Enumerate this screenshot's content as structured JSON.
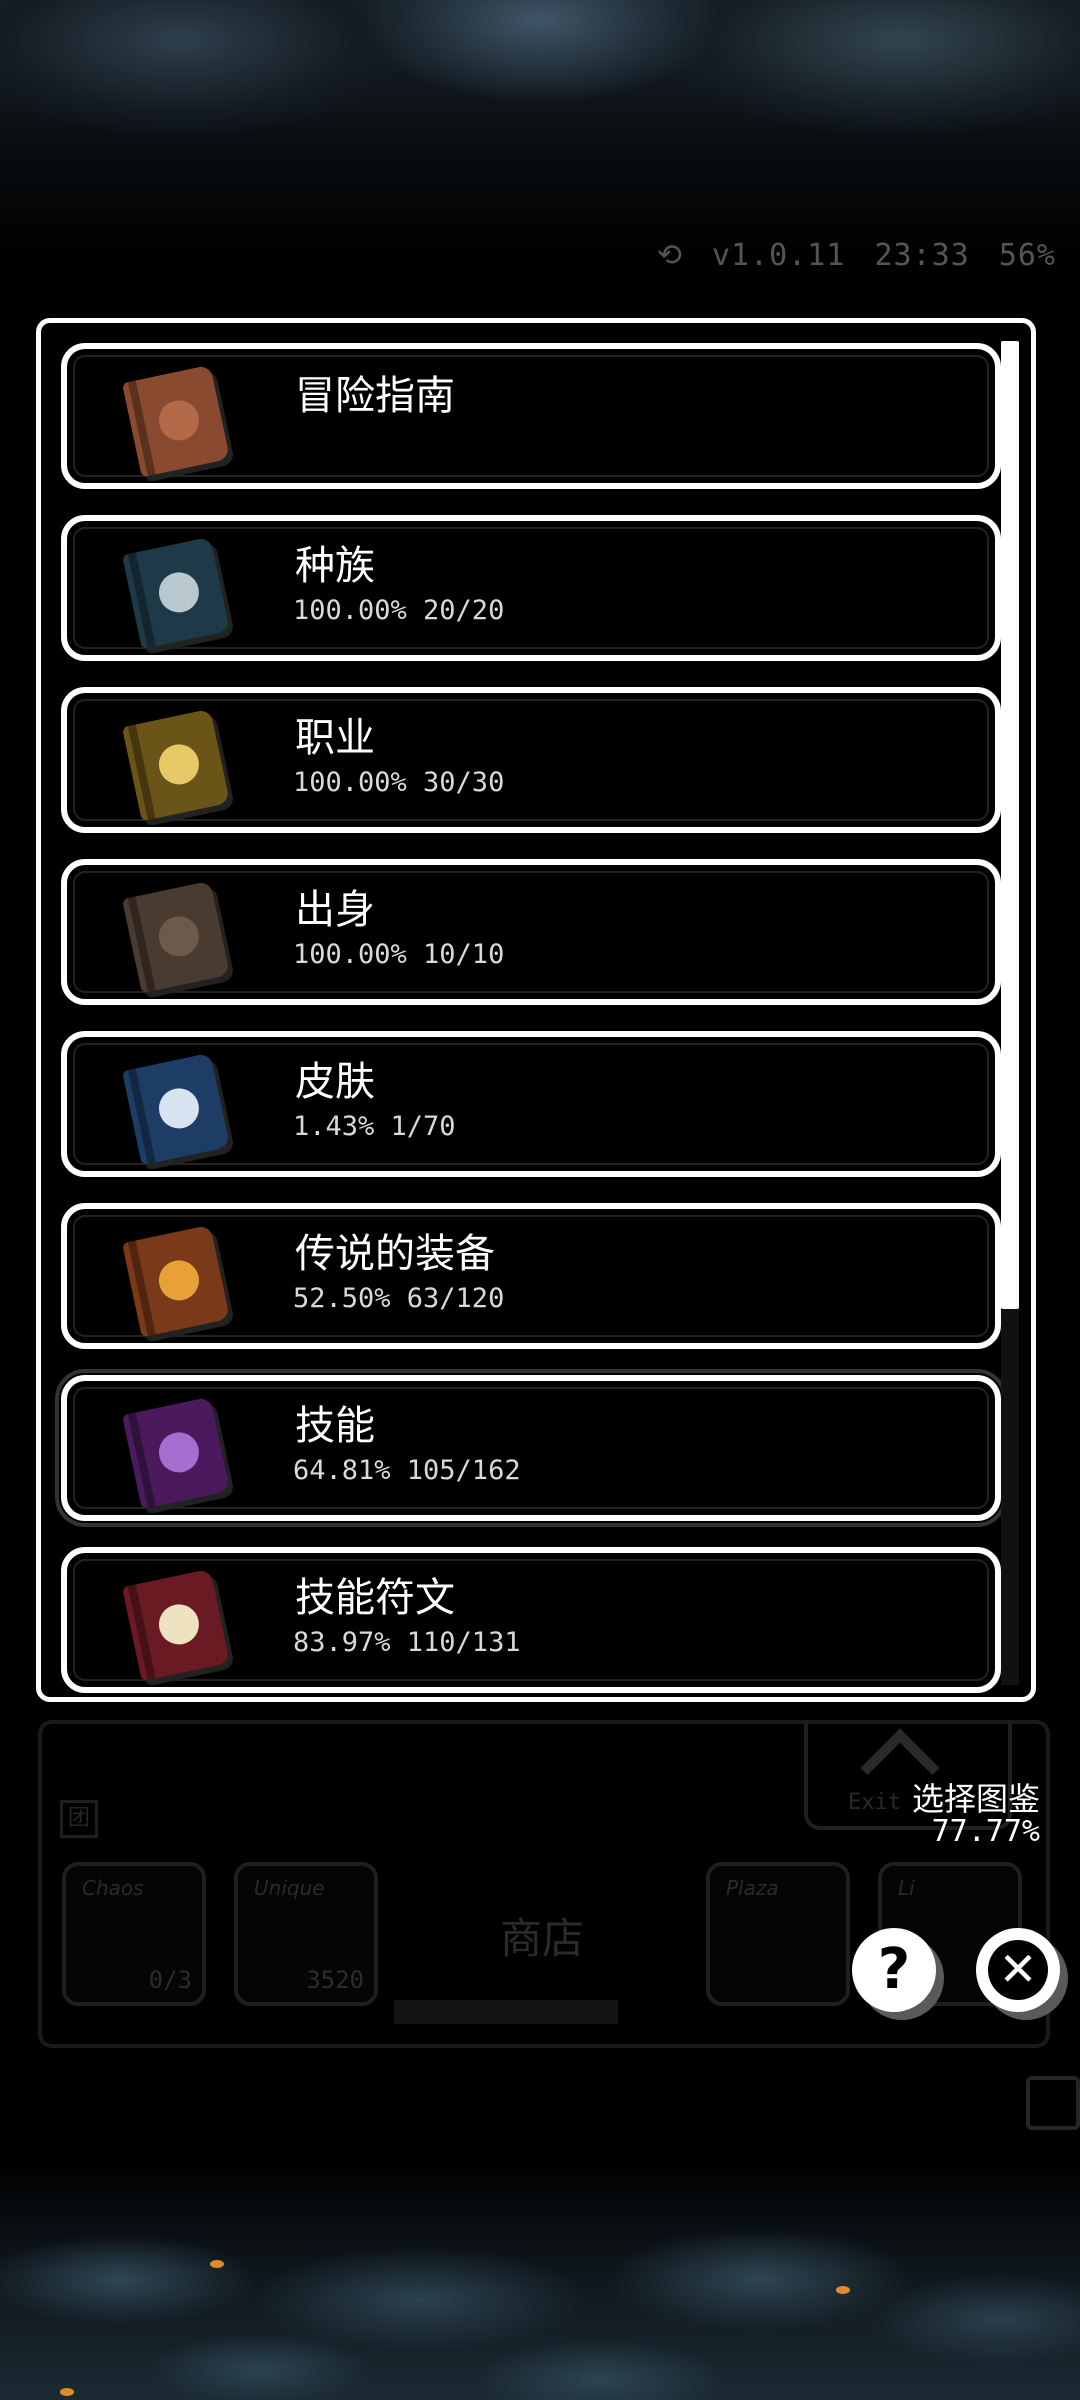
{
  "status": {
    "version": "v1.0.11",
    "time": "23:33",
    "battery": "56%"
  },
  "background": {
    "slots": [
      {
        "title": "Chaos",
        "count": "0/3"
      },
      {
        "title": "Unique",
        "count": "3520"
      },
      {
        "title": "Plaza",
        "count": ""
      },
      {
        "title": "Li",
        "count": ""
      }
    ],
    "shop_label": "商店",
    "exit_label": "Exit"
  },
  "catalog": {
    "items": [
      {
        "name": "冒险指南",
        "stat": "",
        "book_color": "#8a4a30",
        "emblem_color": "#b36a48",
        "icon": "guide-book-icon"
      },
      {
        "name": "种族",
        "stat": "100.00% 20/20",
        "book_color": "#1e3947",
        "emblem_color": "#b9c7cf",
        "icon": "race-book-icon"
      },
      {
        "name": "职业",
        "stat": "100.00% 30/30",
        "book_color": "#6a5418",
        "emblem_color": "#e6c867",
        "icon": "class-book-icon"
      },
      {
        "name": "出身",
        "stat": "100.00% 10/10",
        "book_color": "#4a3b31",
        "emblem_color": "#6d5a4c",
        "icon": "origin-book-icon"
      },
      {
        "name": "皮肤",
        "stat": "1.43% 1/70",
        "book_color": "#1e3d66",
        "emblem_color": "#d7e3f0",
        "icon": "skin-book-icon"
      },
      {
        "name": "传说的装备",
        "stat": "52.50% 63/120",
        "book_color": "#7a3a1a",
        "emblem_color": "#e8a038",
        "icon": "legendary-gear-book-icon"
      },
      {
        "name": "技能",
        "stat": "64.81% 105/162",
        "book_color": "#4a1a5c",
        "emblem_color": "#a46fd0",
        "icon": "skill-book-icon"
      },
      {
        "name": "技能符文",
        "stat": "83.97% 110/131",
        "book_color": "#6a1a22",
        "emblem_color": "#efe2c0",
        "icon": "skill-rune-book-icon"
      }
    ],
    "scroll_fraction": 0.72
  },
  "select": {
    "label": "选择图鉴",
    "percent": "77.77%"
  },
  "buttons": {
    "help": "?",
    "close": "✕"
  }
}
